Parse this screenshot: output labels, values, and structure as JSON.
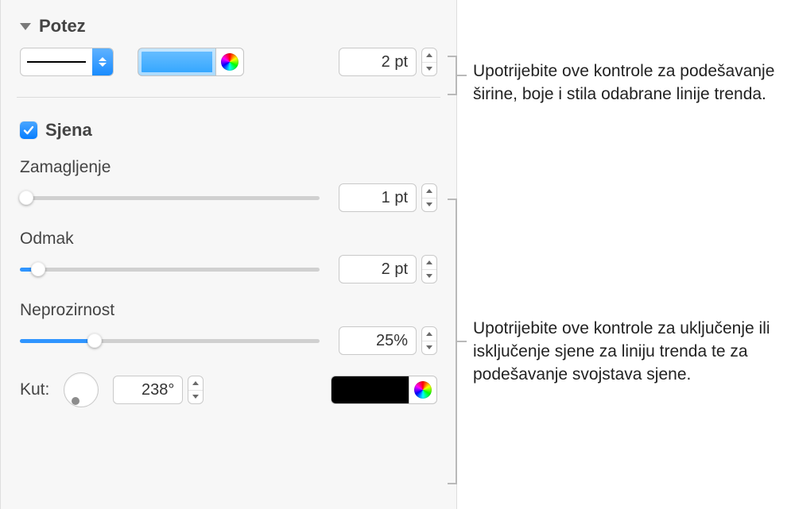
{
  "stroke": {
    "section_title": "Potez",
    "width_value": "2 pt",
    "swatch_color": "#3ba4ff"
  },
  "shadow": {
    "checkbox_checked": true,
    "section_title": "Sjena",
    "blur_label": "Zamagljenje",
    "blur_value": "1 pt",
    "blur_fill_pct": 2,
    "offset_label": "Odmak",
    "offset_value": "2 pt",
    "offset_fill_pct": 6,
    "opacity_label": "Neprozirnost",
    "opacity_value": "25%",
    "opacity_fill_pct": 25,
    "angle_label": "Kut:",
    "angle_value": "238°",
    "angle_deg": 238,
    "shadow_color": "#000000"
  },
  "callouts": {
    "stroke_text": "Upotrijebite ove kontrole za podešavanje širine, boje i stila odabrane linije trenda.",
    "shadow_text": "Upotrijebite ove kontrole za uključenje ili isključenje sjene za liniju trenda te za podešavanje svojstava sjene."
  }
}
